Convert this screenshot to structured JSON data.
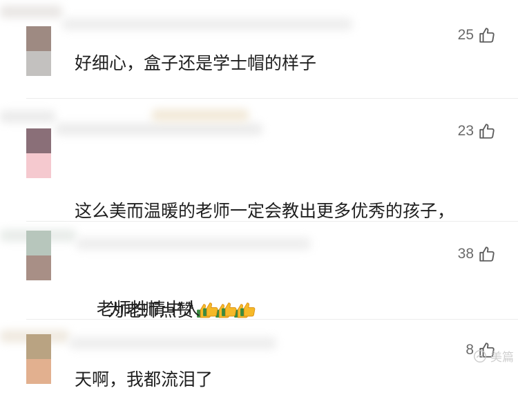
{
  "comments": [
    {
      "text": "好细心，盒子还是学士帽的样子",
      "likes": "25",
      "avatar_colors": [
        "#9e8a82",
        "#b9b6b3"
      ],
      "emoji_count": 0
    },
    {
      "text": "这么美而温暖的老师一定会教出更多优秀的孩子，",
      "text_line2": "为老师点赞",
      "likes": "23",
      "avatar_colors": [
        "#8a6f78",
        "#f5c9cf"
      ],
      "emoji_count": 3
    },
    {
      "text": "老师性情中人",
      "likes": "38",
      "avatar_colors": [
        "#b7c6bc",
        "#a88f86"
      ],
      "emoji_count": 3
    },
    {
      "text": "天啊，我都流泪了",
      "likes": "8",
      "avatar_colors": [
        "#b9a382",
        "#e2b08f"
      ],
      "emoji_count": 0
    }
  ],
  "watermark": {
    "text": "美篇"
  },
  "icons": {
    "like": "thumbs-up-outline-icon",
    "emoji": "thumbs-up-emoji-icon",
    "watermark": "meipian-logo-icon"
  },
  "colors": {
    "text": "#1f1f1f",
    "like_count": "#6a6a6a",
    "divider": "#ececec"
  }
}
